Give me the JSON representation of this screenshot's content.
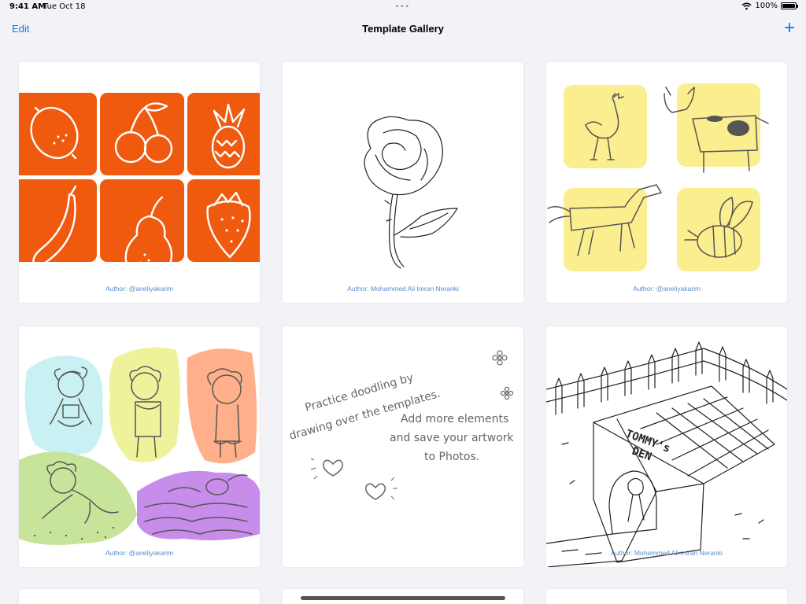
{
  "status": {
    "time": "9:41 AM",
    "date": "Tue Oct 18",
    "battery": "100%"
  },
  "nav": {
    "edit": "Edit",
    "title": "Template Gallery",
    "add": "+"
  },
  "templates": [
    {
      "author": "Author: @aneliyakarim",
      "art": "fruit-grid"
    },
    {
      "author": "Author: Mohammed Ali Imran Neranki",
      "art": "rose"
    },
    {
      "author": "Author: @aneliyakarim",
      "art": "farm-animals"
    },
    {
      "author": "Author: @aneliyakarim",
      "art": "girl-doodles"
    },
    {
      "author": "",
      "art": "practice-text"
    },
    {
      "author": "Author: Mohammed Ali Imran Neranki",
      "art": "dog-house"
    }
  ],
  "practice": {
    "line1": "Practice doodling by",
    "line2": "drawing over the templates.",
    "line3": "Add more elements",
    "line4": "and save your artwork",
    "line5": "to Photos."
  },
  "doghouse_sign": {
    "line1": "TOMMY's",
    "line2": "DEN"
  },
  "colors": {
    "accent": "#0a7aff",
    "orange": "#f05a0f",
    "yellow": "#faee8f",
    "author": "#5a8cc9"
  }
}
